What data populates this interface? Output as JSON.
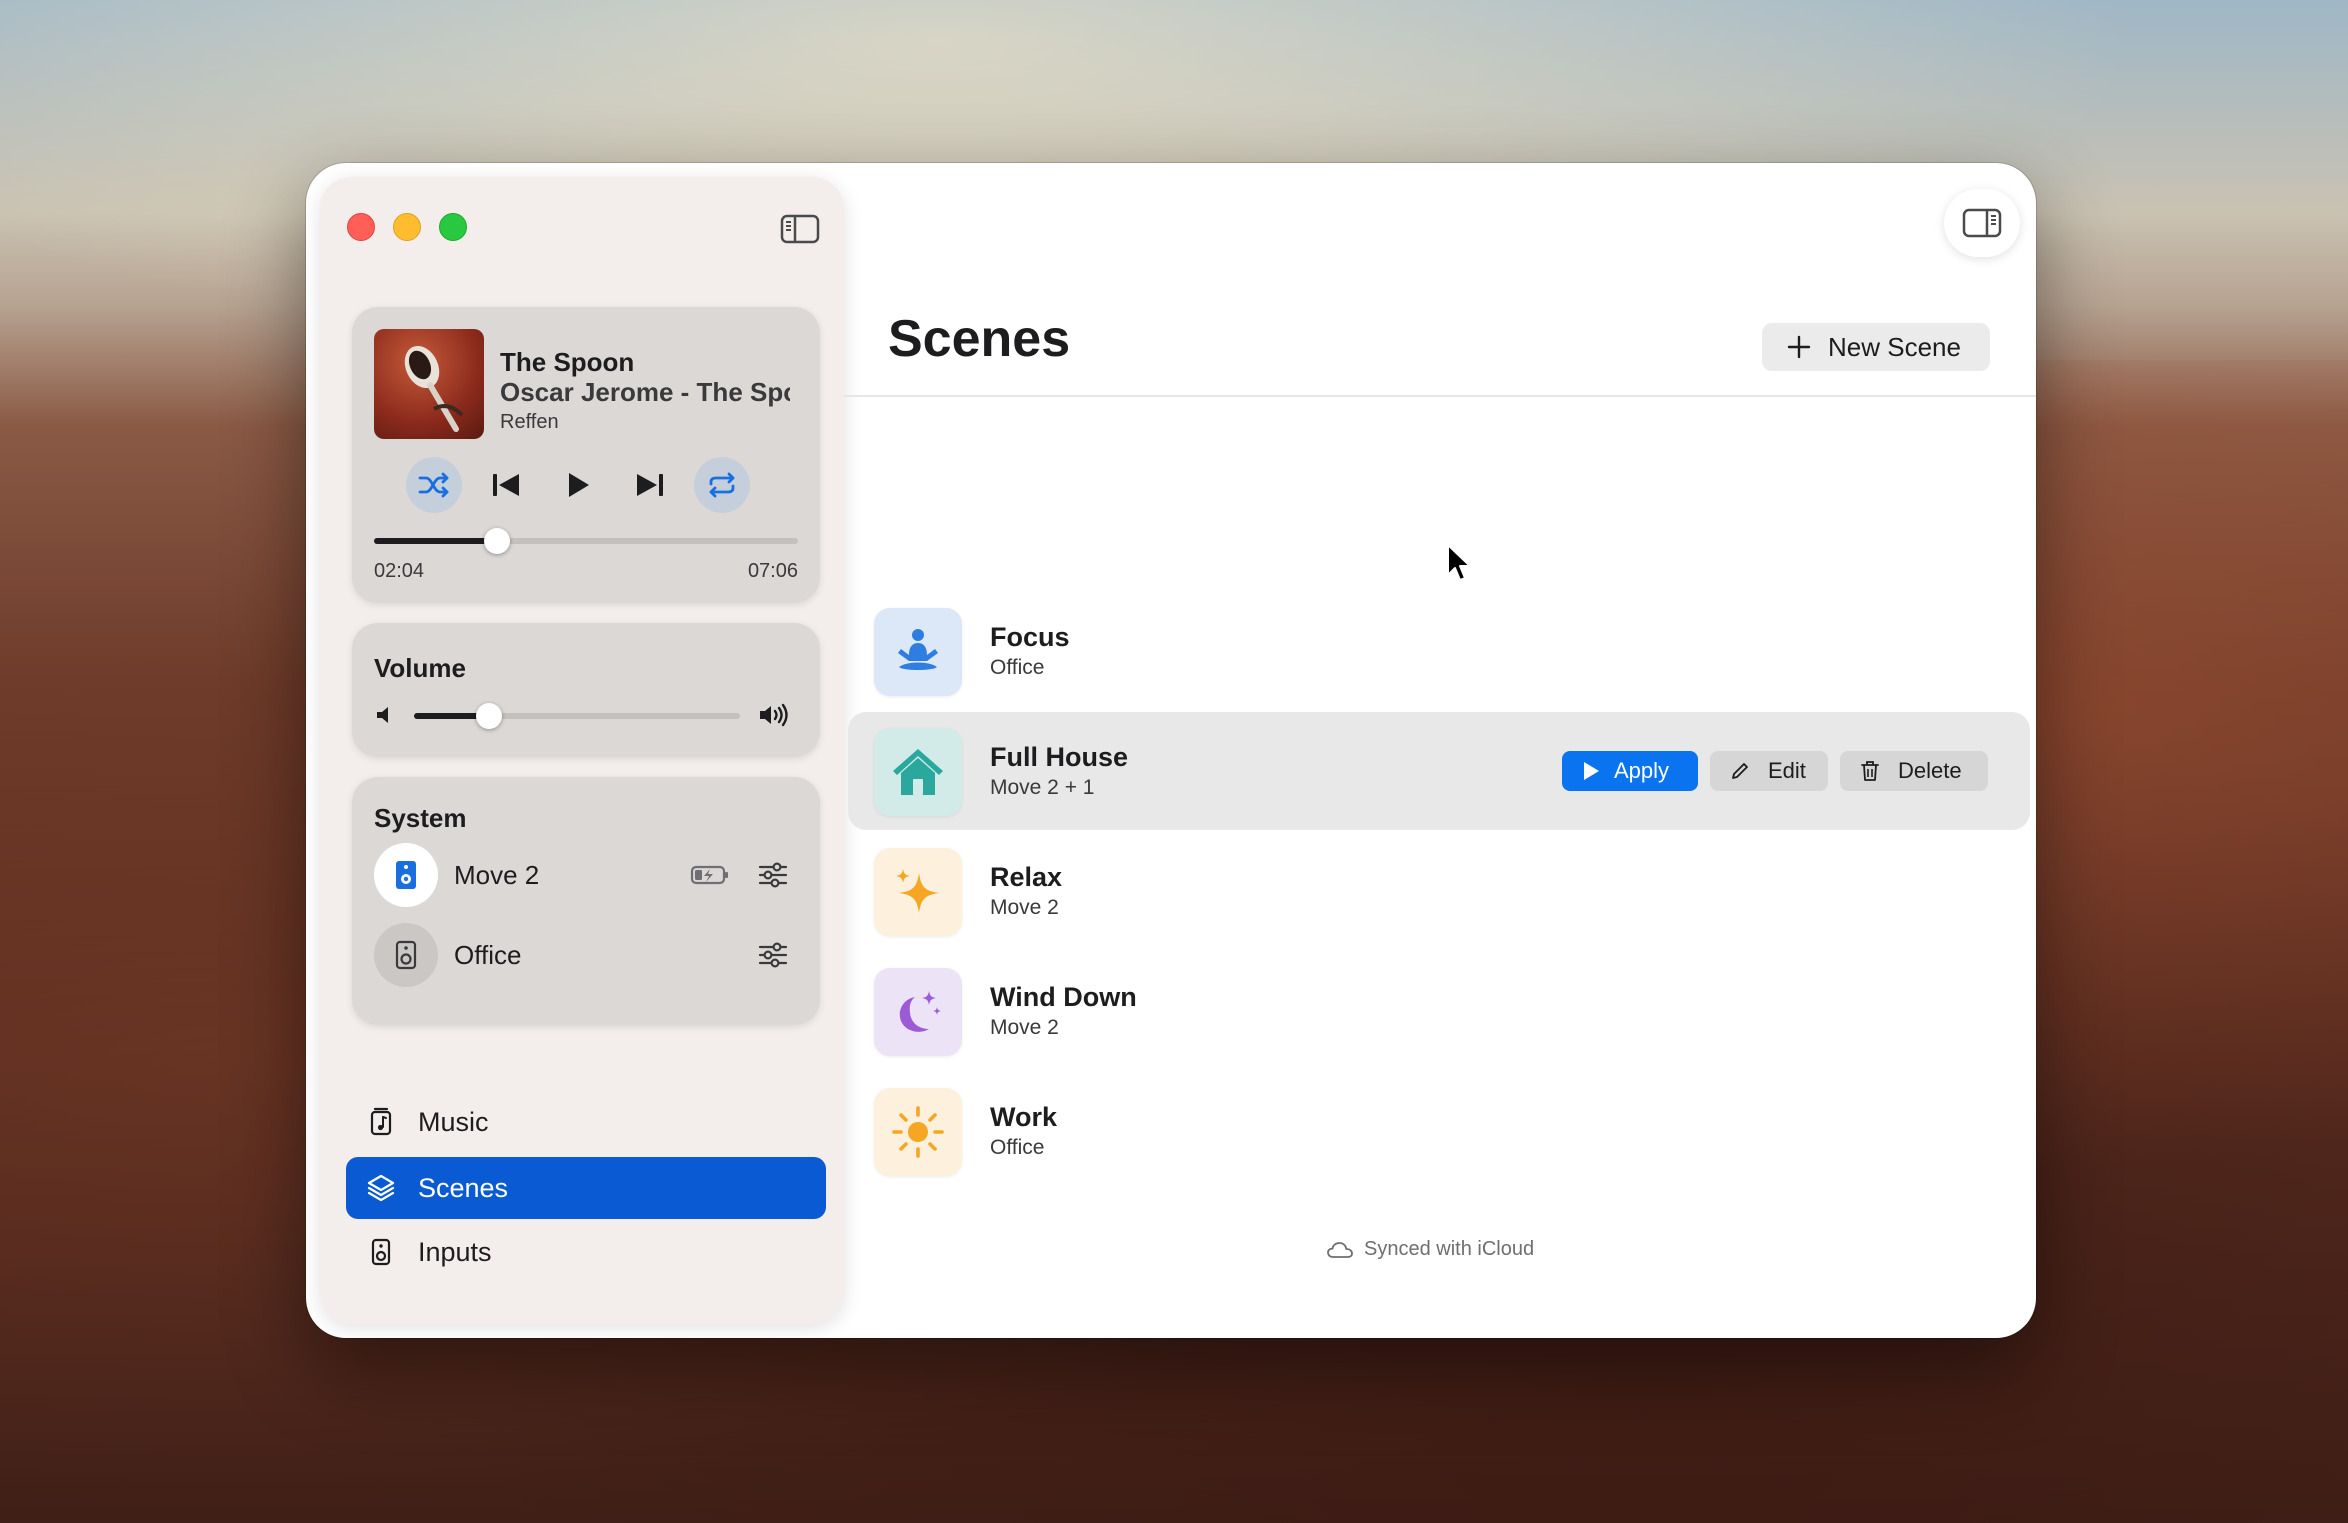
{
  "colors": {
    "accent": "#0a5bd3",
    "apply": "#0a74f0",
    "focus_tile": "#dce7f8",
    "fullhouse_tile": "#d2ebe8",
    "relax_tile": "#fdf0dc",
    "winddown_tile": "#ece3f6",
    "work_tile": "#fdf0dc"
  },
  "now_playing": {
    "title": "The Spoon",
    "artist": "Oscar Jerome - The Spoon",
    "source": "Reffen",
    "elapsed": "02:04",
    "total": "07:06",
    "progress": 0.29,
    "shuffle_active": true,
    "repeat_active": true,
    "icons": [
      "shuffle-icon",
      "previous-track-icon",
      "play-icon",
      "next-track-icon",
      "repeat-icon"
    ]
  },
  "volume": {
    "label": "Volume",
    "level": 0.23
  },
  "system": {
    "label": "System",
    "devices": [
      {
        "name": "Move 2",
        "icon": "speaker-icon",
        "battery": "charging"
      },
      {
        "name": "Office",
        "icon": "speaker-icon"
      }
    ]
  },
  "nav": {
    "items": [
      {
        "label": "Music",
        "icon": "music-note-icon"
      },
      {
        "label": "Scenes",
        "icon": "layers-icon",
        "selected": true
      },
      {
        "label": "Inputs",
        "icon": "speaker-icon"
      }
    ]
  },
  "main": {
    "title": "Scenes",
    "new_scene_label": "New Scene",
    "scenes": [
      {
        "name": "Focus",
        "devices": "Office",
        "icon": "meditation-icon"
      },
      {
        "name": "Full House",
        "devices": "Move 2 + 1",
        "icon": "house-icon"
      },
      {
        "name": "Relax",
        "devices": "Move 2",
        "icon": "sparkles-icon"
      },
      {
        "name": "Wind Down",
        "devices": "Move 2",
        "icon": "moon-icon"
      },
      {
        "name": "Work",
        "devices": "Office",
        "icon": "sun-icon"
      }
    ],
    "row_actions": {
      "apply": "Apply",
      "edit": "Edit",
      "delete": "Delete"
    },
    "sync_status": "Synced with iCloud"
  }
}
